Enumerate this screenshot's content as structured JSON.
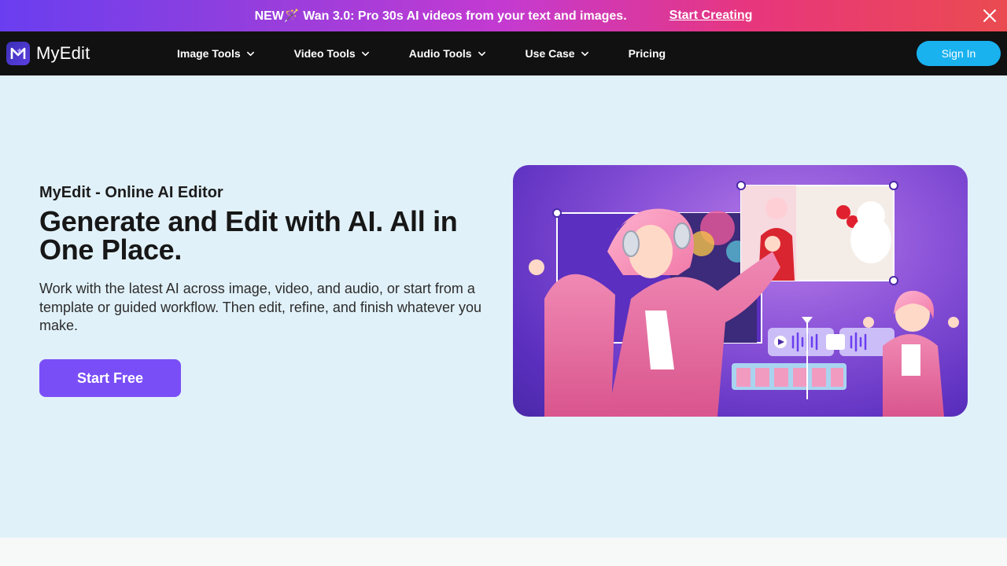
{
  "promo": {
    "text": "NEW🪄 Wan 3.0: Pro 30s AI videos from your text and images.",
    "link": "Start Creating"
  },
  "nav": {
    "logo_text": "MyEdit",
    "items": [
      {
        "label": "Image Tools",
        "dropdown": true
      },
      {
        "label": "Video Tools",
        "dropdown": true
      },
      {
        "label": "Audio Tools",
        "dropdown": true
      },
      {
        "label": "Use Case",
        "dropdown": true
      },
      {
        "label": "Pricing",
        "dropdown": false
      }
    ],
    "signin": "Sign In"
  },
  "hero": {
    "eyebrow": "MyEdit - Online AI Editor",
    "headline": "Generate and Edit with AI. All in One Place.",
    "sub": "Work with the latest AI across image, video, and audio, or start from a template or guided workflow. Then edit, refine, and finish whatever you make.",
    "cta": "Start Free"
  },
  "colors": {
    "hero_bg": "#e1f1f9",
    "nav_bg": "#111111",
    "cta": "#7a4ef7",
    "signin": "#19b2ef"
  }
}
